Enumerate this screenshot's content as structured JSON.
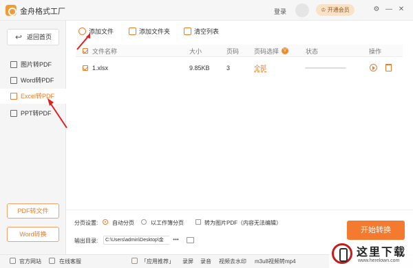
{
  "app": {
    "title": "金舟格式工厂",
    "login": "登录",
    "vip": "开通会员"
  },
  "window_controls": {
    "settings": "⚙",
    "minimize": "—",
    "close": "✕"
  },
  "sidebar": {
    "back_label": "返回首页",
    "items": [
      {
        "label": "图片转PDF",
        "active": false
      },
      {
        "label": "Word转PDF",
        "active": false
      },
      {
        "label": "Excel转PDF",
        "active": true
      },
      {
        "label": "PPT转PDF",
        "active": false
      }
    ],
    "pdf_convert": "PDF转文件",
    "word_convert": "Word转换"
  },
  "toolbar": {
    "add_file": "添加文件",
    "add_folder": "添加文件夹",
    "clear_list": "清空列表"
  },
  "table": {
    "headers": {
      "name": "文件名称",
      "size": "大小",
      "pages": "页码",
      "page_select": "页码选择",
      "status": "状态",
      "action": "操作"
    },
    "page_select_badge": "V",
    "rows": [
      {
        "name": "1.xlsx",
        "size": "9.85KB",
        "pages": "3",
        "page_select": "全部",
        "progress": 0
      }
    ]
  },
  "options": {
    "paging_label": "分页设置:",
    "auto_paging": "自动分页",
    "sheet_paging": "以工作簿分页",
    "to_image_pdf": "转为图片PDF（内容无法编辑）",
    "output_label": "输出目录:",
    "output_path": "C:\\Users\\admin\\Desktop\\金",
    "output_more": "•••"
  },
  "start_button": "开始转换",
  "statusbar": {
    "website": "官方网站",
    "support": "在线客服",
    "recommend": "「应用推荐」",
    "screen_record": "录屏",
    "audio_record": "录音",
    "remove_watermark": "视频去水印",
    "m3u8": "m3u8视频转mp4"
  },
  "watermark": {
    "brand": "这里下载",
    "url": "www.herelown.com"
  }
}
